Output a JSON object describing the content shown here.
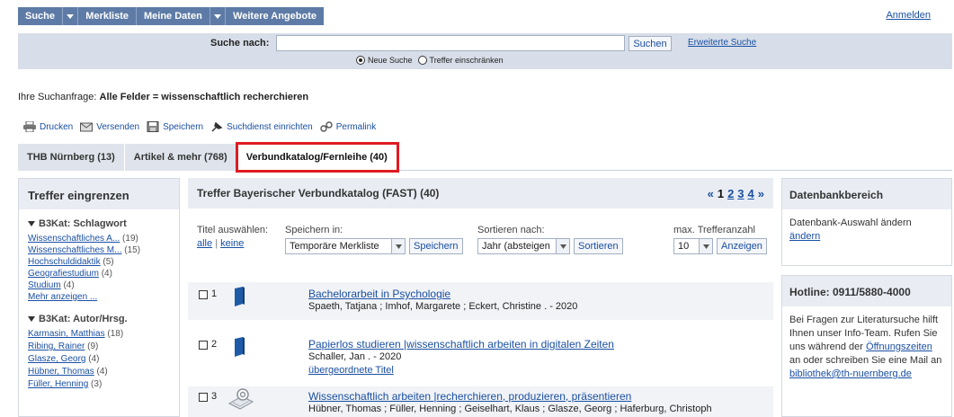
{
  "nav": {
    "search": "Suche",
    "watchlist": "Merkliste",
    "mydata": "Meine Daten",
    "more": "Weitere Angebote",
    "login": "Anmelden"
  },
  "search": {
    "label": "Suche nach:",
    "value": "",
    "button": "Suchen",
    "advanced": "Erweiterte Suche",
    "radio_new": "Neue Suche",
    "radio_refine": "Treffer einschränken"
  },
  "query": {
    "prefix": "Ihre Suchanfrage:",
    "text": "Alle Felder = wissenschaftlich recherchieren"
  },
  "toolbar": {
    "print": "Drucken",
    "send": "Versenden",
    "save": "Speichern",
    "alert": "Suchdienst einrichten",
    "permalink": "Permalink"
  },
  "tabs": [
    {
      "label": "THB Nürnberg (13)"
    },
    {
      "label": "Artikel & mehr (768)"
    },
    {
      "label": "Verbundkatalog/Fernleihe (40)"
    }
  ],
  "sidebar": {
    "title": "Treffer eingrenzen",
    "facets": [
      {
        "title": "B3Kat: Schlagwort",
        "items": [
          {
            "label": "Wissenschaftliches A...",
            "count": "(19)"
          },
          {
            "label": "Wissenschaftliches M...",
            "count": "(15)"
          },
          {
            "label": "Hochschuldidaktik",
            "count": "(5)"
          },
          {
            "label": "Geografiestudium",
            "count": "(4)"
          },
          {
            "label": "Studium",
            "count": "(4)"
          }
        ],
        "more": "Mehr anzeigen ..."
      },
      {
        "title": "B3Kat: Autor/Hrsg.",
        "items": [
          {
            "label": "Karmasin, Matthias",
            "count": "(18)"
          },
          {
            "label": "Ribing, Rainer",
            "count": "(9)"
          },
          {
            "label": "Glasze, Georg",
            "count": "(4)"
          },
          {
            "label": "Hübner, Thomas",
            "count": "(4)"
          },
          {
            "label": "Füller, Henning",
            "count": "(3)"
          }
        ]
      }
    ]
  },
  "main": {
    "title": "Treffer Bayerischer Verbundkatalog (FAST) (40)",
    "pager": {
      "prev": "«",
      "current": "1",
      "pages": [
        "2",
        "3",
        "4"
      ],
      "next": "»"
    },
    "select_title": "Titel auswählen:",
    "select_all": "alle",
    "select_sep": "|",
    "select_none": "keine",
    "save_in_label": "Speichern in:",
    "save_in_value": "Temporäre Merkliste",
    "save_button": "Speichern",
    "sort_label": "Sortieren nach:",
    "sort_value": "Jahr (absteigen",
    "sort_button": "Sortieren",
    "max_label": "max. Trefferanzahl",
    "max_value": "10",
    "max_button": "Anzeigen"
  },
  "results": [
    {
      "num": "1",
      "type": "book-icon",
      "title": "Bachelorarbeit in Psychologie",
      "meta": "Spaeth, Tatjana ; Imhof, Margarete ; Eckert, Christine . - 2020"
    },
    {
      "num": "2",
      "type": "book-icon",
      "title": "Papierlos studieren |wissenschaftlich arbeiten in digitalen Zeiten",
      "meta": "Schaller, Jan . - 2020",
      "link": "übergeordnete Titel"
    },
    {
      "num": "3",
      "type": "ebook-icon",
      "title": "Wissenschaftlich arbeiten |recherchieren, produzieren, präsentieren",
      "meta": "Hübner, Thomas ; Füller, Henning ; Geiselhart, Klaus ; Glasze, Georg ; Haferburg, Christoph"
    }
  ],
  "right": {
    "db_title": "Datenbankbereich",
    "db_text": "Datenbank-Auswahl ändern",
    "db_link": "ändern",
    "hotline_title": "Hotline: 0911/5880-4000",
    "hotline_text1": "Bei Fragen zur Literatursuche hilft Ihnen unser Info-Team. Rufen Sie uns während der",
    "hotline_link1": "Öffnungszeiten",
    "hotline_text2": "an oder schreiben Sie eine Mail an",
    "hotline_link2": "bibliothek@th-nuernberg.de"
  },
  "colors": {
    "nav_bg": "#5d7ba6",
    "search_band": "#d7dee9",
    "link": "#1a4fa3",
    "active_tab_outline": "#e01b22",
    "book_icon": "#1f5aa6"
  }
}
